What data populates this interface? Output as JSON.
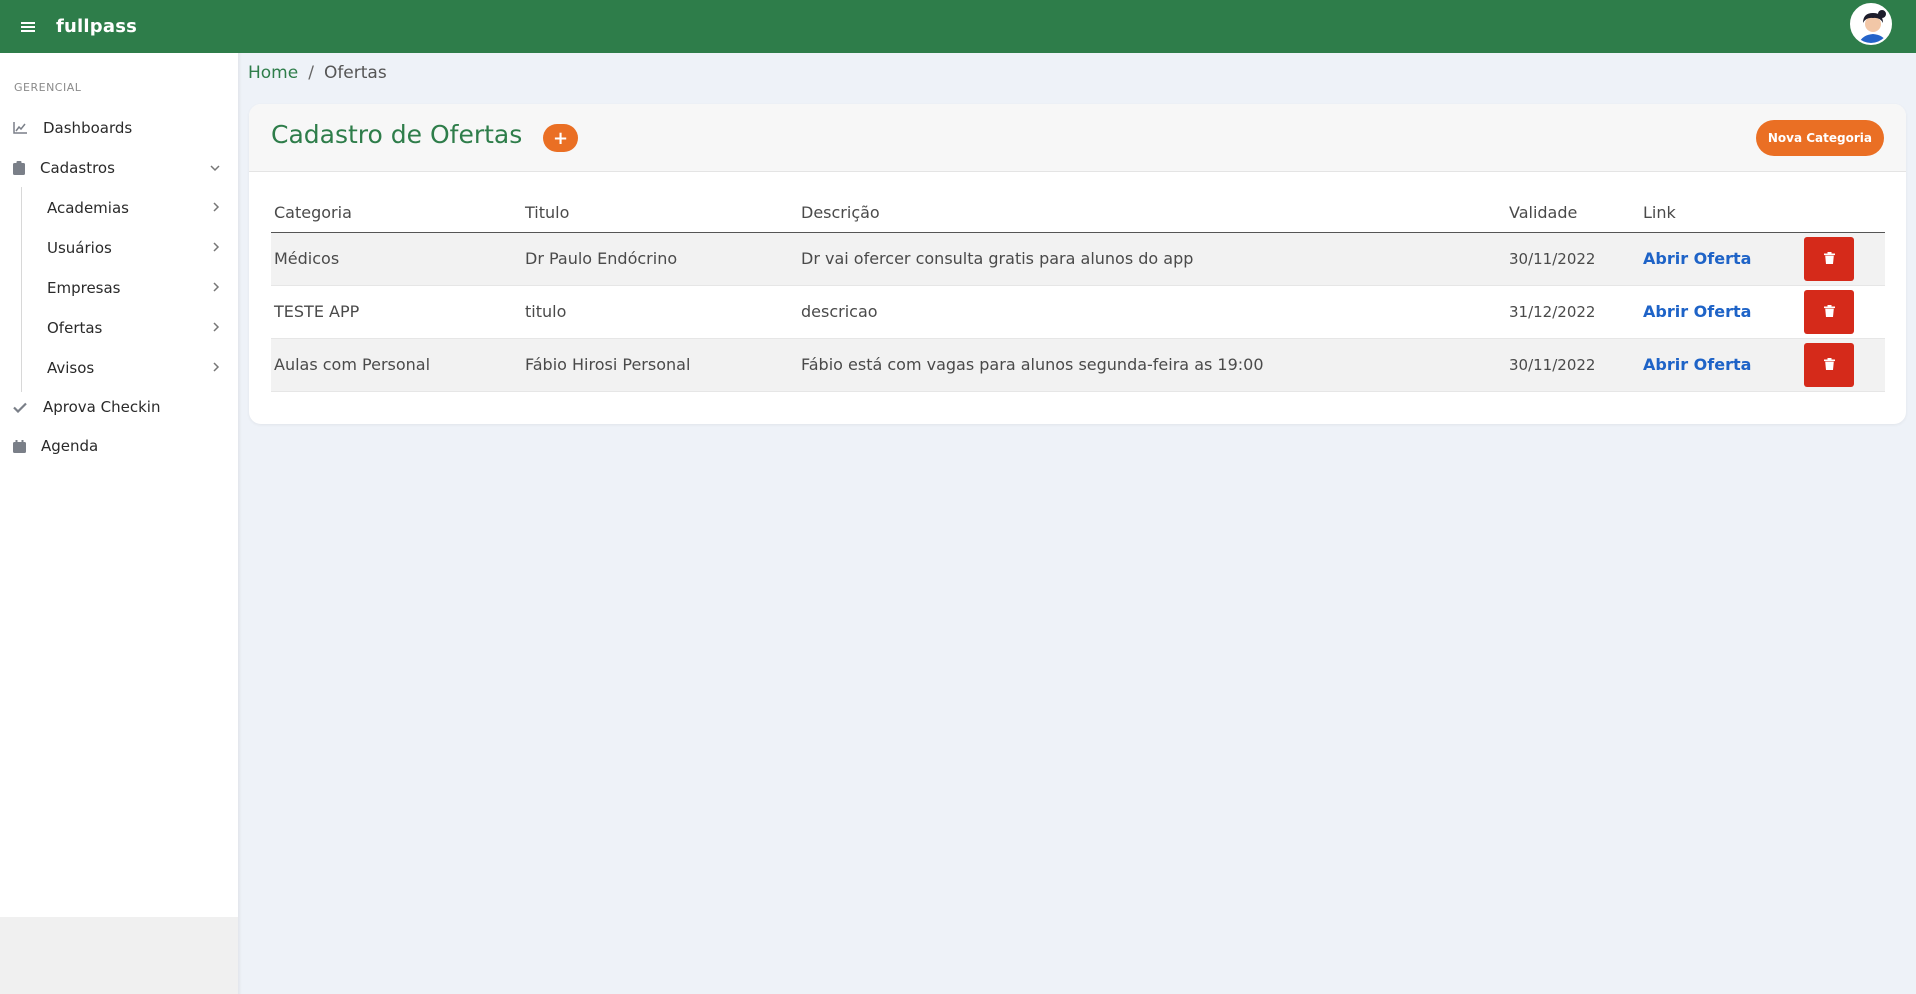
{
  "app": {
    "brand": "fullpass"
  },
  "sidebar": {
    "section": "GERENCIAL",
    "items": [
      {
        "label": "Dashboards",
        "icon": "chart-line-icon"
      },
      {
        "label": "Cadastros",
        "icon": "clipboard-icon"
      },
      {
        "label": "Aprova Checkin",
        "icon": "check-icon"
      },
      {
        "label": "Agenda",
        "icon": "calendar-icon"
      }
    ],
    "subitems": [
      {
        "label": "Academias"
      },
      {
        "label": "Usuários"
      },
      {
        "label": "Empresas"
      },
      {
        "label": "Ofertas"
      },
      {
        "label": "Avisos"
      }
    ]
  },
  "breadcrumb": {
    "home": "Home",
    "separator": "/",
    "current": "Ofertas"
  },
  "card": {
    "title": "Cadastro de Ofertas",
    "add_label": "+",
    "new_category_label": "Nova Categoria"
  },
  "table": {
    "headers": [
      "Categoria",
      "Titulo",
      "Descrição",
      "Validade",
      "Link"
    ],
    "rows": [
      {
        "categoria": "Médicos",
        "titulo": "Dr Paulo Endócrino",
        "descricao": "Dr vai ofercer consulta gratis para alunos do app",
        "validade": "30/11/2022",
        "link": "Abrir Oferta"
      },
      {
        "categoria": "TESTE APP",
        "titulo": "titulo",
        "descricao": "descricao",
        "validade": "31/12/2022",
        "link": "Abrir Oferta"
      },
      {
        "categoria": "Aulas com Personal",
        "titulo": "Fábio Hirosi Personal",
        "descricao": "Fábio está com vagas para alunos segunda-feira as 19:00",
        "validade": "30/11/2022",
        "link": "Abrir Oferta"
      }
    ]
  },
  "colors": {
    "brand_green": "#2e7d4a",
    "accent_orange": "#ea6f24",
    "danger_red": "#d52a1a",
    "link_blue": "#1e63c7"
  }
}
